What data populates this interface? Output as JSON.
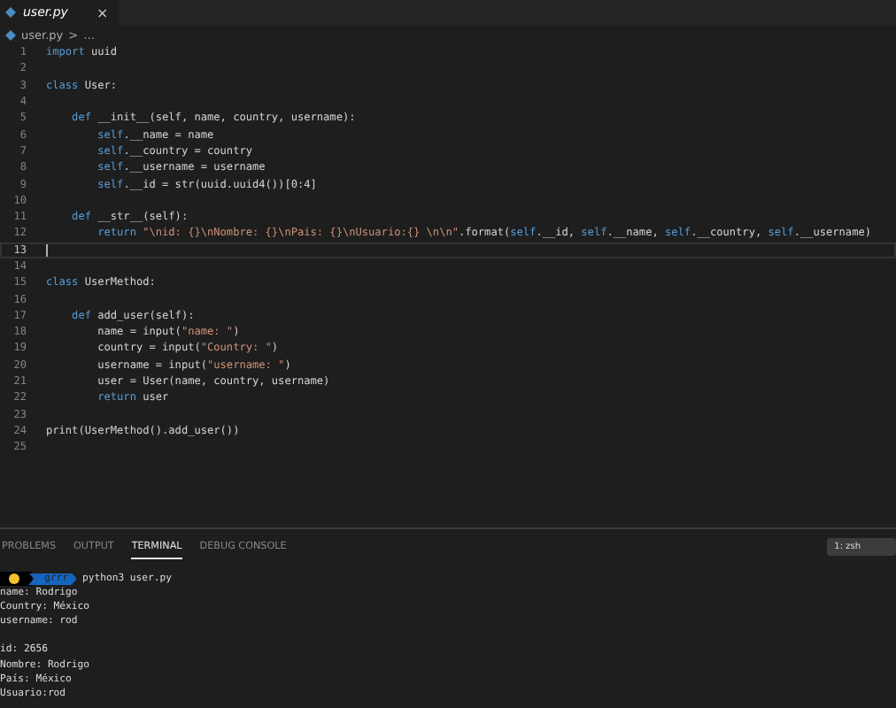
{
  "editor_tab": {
    "label": "user.py",
    "close": "×",
    "selected": true
  },
  "breadcrumb": {
    "file": "user.py",
    "separator": ">",
    "rest": "…"
  },
  "code_lines": [
    {
      "number": "1",
      "tokens": [
        {
          "kind": "keyword",
          "text": "import"
        },
        {
          "kind": "plain",
          "text": " uuid"
        }
      ]
    },
    {
      "number": "2"
    },
    {
      "number": "3",
      "tokens": [
        {
          "kind": "keyword",
          "text": "class"
        },
        {
          "kind": "plain",
          "text": " User:"
        }
      ]
    },
    {
      "number": "4"
    },
    {
      "number": "5",
      "tokens": [
        {
          "kind": "keyword",
          "text": "    def"
        },
        {
          "kind": "plain",
          "text": " __init__(self, name, country, username):"
        }
      ]
    },
    {
      "number": "6",
      "tokens": [
        {
          "kind": "self",
          "text": "        self"
        },
        {
          "kind": "plain",
          "text": ".__name = name"
        }
      ]
    },
    {
      "number": "7",
      "tokens": [
        {
          "kind": "self",
          "text": "        self"
        },
        {
          "kind": "plain",
          "text": ".__country = country"
        }
      ]
    },
    {
      "number": "8",
      "tokens": [
        {
          "kind": "self",
          "text": "        self"
        },
        {
          "kind": "plain",
          "text": ".__username = username"
        }
      ]
    },
    {
      "number": "9",
      "tokens": [
        {
          "kind": "self",
          "text": "        self"
        },
        {
          "kind": "plain",
          "text": ".__id = str(uuid.uuid4())[0:4]"
        }
      ]
    },
    {
      "number": "10"
    },
    {
      "number": "11",
      "tokens": [
        {
          "kind": "keyword",
          "text": "    def"
        },
        {
          "kind": "plain",
          "text": " __str__(self):"
        }
      ]
    },
    {
      "number": "12",
      "tokens": [
        {
          "kind": "keyword",
          "text": "        return "
        },
        {
          "kind": "string",
          "text": "\"\\nid: {}\\nNombre: {}\\nPais: {}\\nUsuario:{} \\n\\n\""
        },
        {
          "kind": "plain",
          "text": ".format("
        },
        {
          "kind": "self",
          "text": "self"
        },
        {
          "kind": "plain",
          "text": ".__id, "
        },
        {
          "kind": "self",
          "text": "self"
        },
        {
          "kind": "plain",
          "text": ".__name, "
        },
        {
          "kind": "self",
          "text": "self"
        },
        {
          "kind": "plain",
          "text": ".__country, "
        },
        {
          "kind": "self",
          "text": "self"
        },
        {
          "kind": "plain",
          "text": ".__username)"
        }
      ]
    },
    {
      "number": "13",
      "current": true
    },
    {
      "number": "14"
    },
    {
      "number": "15",
      "tokens": [
        {
          "kind": "keyword",
          "text": "class"
        },
        {
          "kind": "plain",
          "text": " UserMethod:"
        }
      ]
    },
    {
      "number": "16"
    },
    {
      "number": "17",
      "tokens": [
        {
          "kind": "keyword",
          "text": "    def"
        },
        {
          "kind": "plain",
          "text": " add_user(self):"
        }
      ]
    },
    {
      "number": "18",
      "tokens": [
        {
          "kind": "plain",
          "text": "        name = input("
        },
        {
          "kind": "string",
          "text": "\"name: \""
        },
        {
          "kind": "plain",
          "text": ")"
        }
      ]
    },
    {
      "number": "19",
      "tokens": [
        {
          "kind": "plain",
          "text": "        country = input("
        },
        {
          "kind": "string",
          "text": "\"Country: \""
        },
        {
          "kind": "plain",
          "text": ")"
        }
      ]
    },
    {
      "number": "20",
      "tokens": [
        {
          "kind": "plain",
          "text": "        username = input("
        },
        {
          "kind": "string",
          "text": "\"username: \""
        },
        {
          "kind": "plain",
          "text": ")"
        }
      ]
    },
    {
      "number": "21",
      "tokens": [
        {
          "kind": "plain",
          "text": "        user = User(name, country, username)"
        }
      ]
    },
    {
      "number": "22",
      "tokens": [
        {
          "kind": "keyword",
          "text": "        return"
        },
        {
          "kind": "plain",
          "text": " user"
        }
      ]
    },
    {
      "number": "23"
    },
    {
      "number": "24",
      "tokens": [
        {
          "kind": "plain",
          "text": "print(UserMethod().add_user())"
        }
      ]
    },
    {
      "number": "25"
    }
  ],
  "panel_tabs": [
    {
      "label": "PROBLEMS",
      "selected": false
    },
    {
      "label": "OUTPUT",
      "selected": false
    },
    {
      "label": "TERMINAL",
      "selected": true
    },
    {
      "label": "DEBUG CONSOLE",
      "selected": false
    }
  ],
  "terminal_select": "1: zsh",
  "terminal": {
    "prompt_dir": "grrr",
    "command": "python3 user.py",
    "blocks": [
      [
        "name: Rodrigo",
        "Country: México",
        "username: rod"
      ],
      [
        "id: 2656",
        "Nombre: Rodrigo",
        "País: México",
        "Usuario:rod"
      ]
    ]
  }
}
